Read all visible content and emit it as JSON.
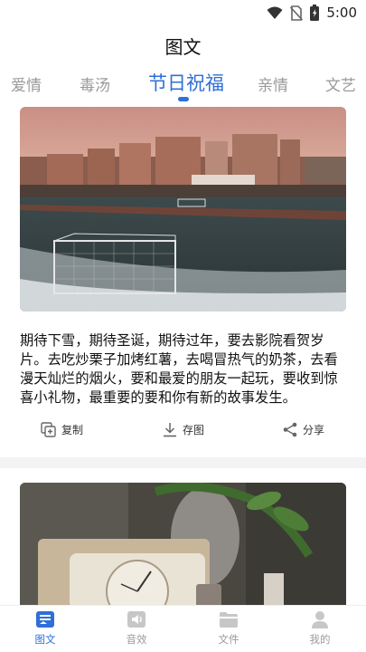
{
  "status_bar": {
    "time": "5:00"
  },
  "page": {
    "title": "图文"
  },
  "tabs": [
    {
      "label": "爱情"
    },
    {
      "label": "毒汤"
    },
    {
      "label": "节日祝福"
    },
    {
      "label": "亲情"
    },
    {
      "label": "文艺"
    }
  ],
  "active_tab": "节日祝福",
  "card": {
    "text": "期待下雪，期待圣诞，期待过年，要去影院看贺岁片。去吃炒栗子加烤红薯，去喝冒热气的奶茶，去看漫天灿烂的烟火，要和最爱的朋友一起玩，要收到惊喜小礼物，最重要的要和你有新的故事发生。",
    "actions": {
      "copy": "复制",
      "save": "存图",
      "share": "分享"
    }
  },
  "bottom_nav": [
    {
      "label": "图文",
      "icon": "image-text-icon"
    },
    {
      "label": "音效",
      "icon": "sound-icon"
    },
    {
      "label": "文件",
      "icon": "folder-icon"
    },
    {
      "label": "我的",
      "icon": "user-icon"
    }
  ],
  "colors": {
    "accent": "#2f6fd6",
    "inactive": "#9a9a9a"
  }
}
